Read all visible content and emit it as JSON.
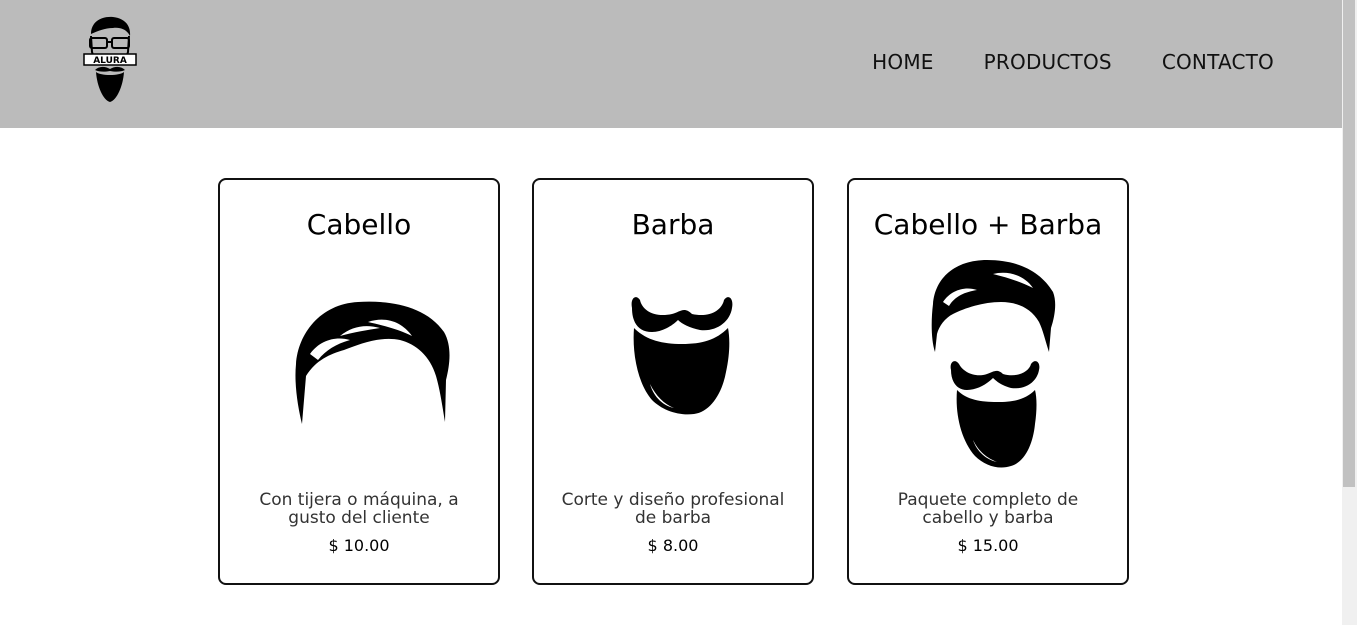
{
  "header": {
    "logo_text": "ALURA",
    "nav": [
      "HOME",
      "PRODUCTOS",
      "CONTACTO"
    ]
  },
  "products": [
    {
      "title": "Cabello",
      "image_icon": "hair-icon",
      "description": "Con tijera o máquina, a gusto del cliente",
      "price": "$ 10.00"
    },
    {
      "title": "Barba",
      "image_icon": "beard-icon",
      "description": "Corte y diseño profesional de barba",
      "price": "$ 8.00"
    },
    {
      "title": "Cabello + Barba",
      "image_icon": "hair-and-beard-icon",
      "description": "Paquete completo de cabello y barba",
      "price": "$ 15.00"
    }
  ]
}
